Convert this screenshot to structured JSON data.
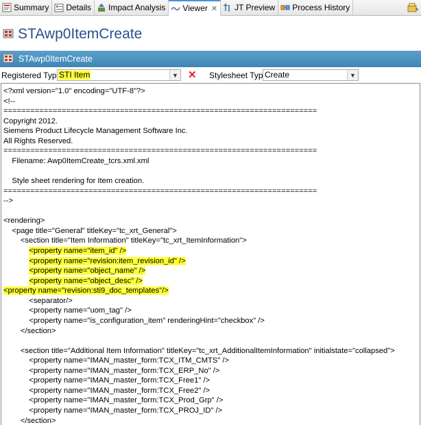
{
  "tabs": [
    {
      "label": "Summary",
      "icon": "summary-icon",
      "active": false
    },
    {
      "label": "Details",
      "icon": "details-icon",
      "active": false
    },
    {
      "label": "Impact Analysis",
      "icon": "impact-analysis-icon",
      "active": false
    },
    {
      "label": "Viewer",
      "icon": "viewer-icon",
      "active": true
    },
    {
      "label": "JT Preview",
      "icon": "jt-preview-icon",
      "active": false
    },
    {
      "label": "Process History",
      "icon": "process-history-icon",
      "active": false
    }
  ],
  "page_title": "STAwp0ItemCreate",
  "section_title": "STAwp0ItemCreate",
  "form": {
    "registered_type_label": "Registered Type:",
    "registered_type_value": "STI Item",
    "stylesheet_type_label": "Stylesheet Type:",
    "stylesheet_type_value": "Create"
  },
  "colors": {
    "accent": "#4a90d9",
    "section_bar": "#4a91bf",
    "title_text": "#2a4f8a",
    "highlight": "#ffff33",
    "clear_button": "#e02020"
  },
  "xml": {
    "lines": [
      {
        "text": "<?xml version=\"1.0\" encoding=\"UTF-8\"?>"
      },
      {
        "text": "<!--"
      },
      {
        "text": "======================================================================"
      },
      {
        "text": "Copyright 2012."
      },
      {
        "text": "Siemens Product Lifecycle Management Software Inc."
      },
      {
        "text": "All Rights Reserved."
      },
      {
        "text": "======================================================================"
      },
      {
        "text": "    Filename: Awp0ItemCreate_tcrs.xml.xml"
      },
      {
        "text": ""
      },
      {
        "text": "    Style sheet rendering for Item creation."
      },
      {
        "text": "======================================================================"
      },
      {
        "text": "-->"
      },
      {
        "text": ""
      },
      {
        "text": "<rendering>"
      },
      {
        "text": "    <page title=\"General\" titleKey=\"tc_xrt_General\">"
      },
      {
        "text": "        <section title=\"Item Information\" titleKey=\"tc_xrt_ItemInformation\">"
      },
      {
        "indent": "            ",
        "text": "<property name=\"item_id\" />",
        "highlight": true
      },
      {
        "indent": "            ",
        "text": "<property name=\"revision:item_revision_id\" />",
        "highlight": true
      },
      {
        "indent": "            ",
        "text": "<property name=\"object_name\" />",
        "highlight": true
      },
      {
        "indent": "            ",
        "text": "<property name=\"object_desc\" />",
        "highlight": true
      },
      {
        "indent": "",
        "text": "<property name=\"revision:sti9_doc_templates\"/>",
        "highlight": true
      },
      {
        "text": "            <separator/>"
      },
      {
        "text": "            <property name=\"uom_tag\" />"
      },
      {
        "text": "            <property name=\"is_configuration_item\" renderingHint=\"checkbox\" />"
      },
      {
        "text": "        </section>"
      },
      {
        "text": ""
      },
      {
        "text": "        <section title=\"Additional Item Information\" titleKey=\"tc_xrt_AdditionalItemInformation\" initialstate=\"collapsed\">"
      },
      {
        "text": "            <property name=\"IMAN_master_form:TCX_ITM_CMTS\" />"
      },
      {
        "text": "            <property name=\"IMAN_master_form:TCX_ERP_No\" />"
      },
      {
        "text": "            <property name=\"IMAN_master_form:TCX_Free1\" />"
      },
      {
        "text": "            <property name=\"IMAN_master_form:TCX_Free2\" />"
      },
      {
        "text": "            <property name=\"IMAN_master_form:TCX_Prod_Grp\" />"
      },
      {
        "text": "            <property name=\"IMAN_master_form:TCX_PROJ_ID\" />"
      },
      {
        "text": "        </section>"
      }
    ]
  }
}
